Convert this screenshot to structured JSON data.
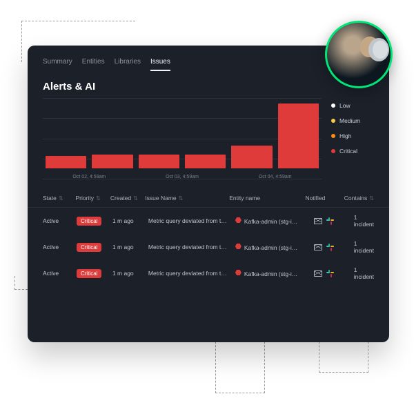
{
  "tabs": [
    "Summary",
    "Entities",
    "Libraries",
    "Issues"
  ],
  "activeTab": "Issues",
  "title": "Alerts & AI",
  "legend": [
    {
      "label": "Low",
      "color": "#ffffff"
    },
    {
      "label": "Medium",
      "color": "#f7c948"
    },
    {
      "label": "High",
      "color": "#ff8c1a"
    },
    {
      "label": "Critical",
      "color": "#e03b3b"
    }
  ],
  "chart_data": {
    "type": "bar",
    "title": "Alerts & AI",
    "xlabel": "",
    "ylabel": "",
    "ylim": [
      0,
      100
    ],
    "categories": [
      "",
      "Oct 02, 4:59am",
      "",
      "Oct 03, 4:59am",
      "",
      "Oct 04, 4:59am"
    ],
    "series": [
      {
        "name": "Critical",
        "color": "#e03b3b",
        "values": [
          18,
          20,
          20,
          20,
          32,
          92
        ]
      }
    ],
    "x_ticks": [
      "Oct 02, 4:59am",
      "Oct 03, 4:59am",
      "Oct 04, 4:59am"
    ],
    "legend_position": "right",
    "grid": true
  },
  "columns": {
    "state": "State",
    "priority": "Priority",
    "created": "Created",
    "issue": "Issue Name",
    "entity": "Entity name",
    "notified": "Notified",
    "contains": "Contains"
  },
  "rows": [
    {
      "state": "Active",
      "priority": "Critical",
      "created": "1 m ago",
      "issue": "Metric query deviated from t…",
      "entity": "Kafka-admin (stg-i…",
      "contains": "1 incident"
    },
    {
      "state": "Active",
      "priority": "Critical",
      "created": "1 m ago",
      "issue": "Metric query deviated from t…",
      "entity": "Kafka-admin (stg-i…",
      "contains": "1 incident"
    },
    {
      "state": "Active",
      "priority": "Critical",
      "created": "1 m ago",
      "issue": "Metric query deviated from t…",
      "entity": "Kafka-admin (stg-i…",
      "contains": "1 incident"
    }
  ]
}
